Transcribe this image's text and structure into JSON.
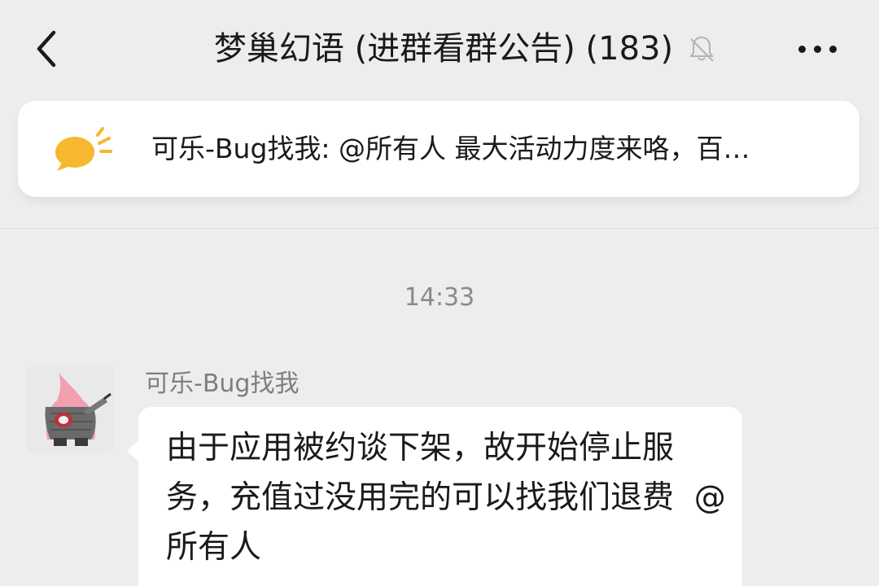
{
  "header": {
    "title": "梦巢幻语 (进群看群公告) (183)",
    "back_icon": "chevron-left-icon",
    "mute_icon": "bell-muted-icon",
    "more_icon": "more-horizontal-icon"
  },
  "announcement": {
    "icon": "megaphone-icon",
    "text": "可乐-Bug找我: @所有人 最大活动力度来咯，百…",
    "accent_color": "#f5b82e"
  },
  "chat": {
    "timestamp": "14:33",
    "messages": [
      {
        "sender": "可乐-Bug找我",
        "text": "由于应用被约谈下架，故开始停止服务，充值过没用完的可以找我们退费  @所有人",
        "avatar_icon": "patrick-star-avatar"
      }
    ]
  }
}
